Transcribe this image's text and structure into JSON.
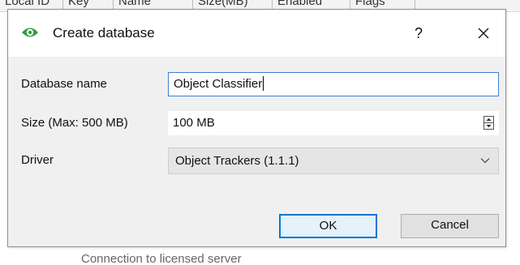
{
  "background_table": {
    "columns": [
      "Local ID",
      "Key",
      "Name",
      "Size(MB)",
      "Enabled",
      "Flags"
    ]
  },
  "background_footer": "Connection to licensed server",
  "dialog": {
    "title": "Create database",
    "help_label": "?",
    "accent_color": "#2e9c3e",
    "fields": {
      "name_label": "Database name",
      "name_value": "Object Classifier",
      "size_label": "Size (Max: 500 MB)",
      "size_value": "100 MB",
      "driver_label": "Driver",
      "driver_value": "Object Trackers (1.1.1)"
    },
    "buttons": {
      "ok": "OK",
      "cancel": "Cancel"
    },
    "icons": {
      "app": "eye-icon",
      "help": "question-icon",
      "close": "close-icon",
      "spin": "spin-arrows-icon",
      "dropdown": "chevron-down-icon"
    }
  }
}
